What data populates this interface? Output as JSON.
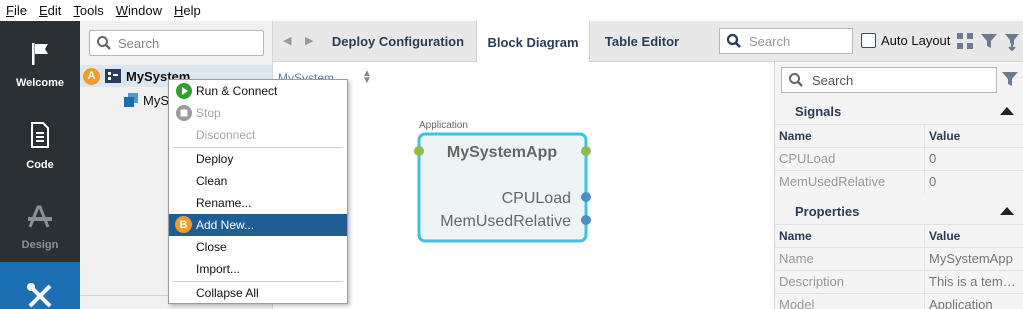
{
  "menubar": {
    "items": [
      {
        "label": "File",
        "u": "F",
        "rest": "ile"
      },
      {
        "label": "Edit",
        "u": "E",
        "rest": "dit"
      },
      {
        "label": "Tools",
        "u": "T",
        "rest": "ools"
      },
      {
        "label": "Window",
        "u": "W",
        "rest": "indow"
      },
      {
        "label": "Help",
        "u": "H",
        "rest": "elp"
      }
    ]
  },
  "rail": {
    "welcome": "Welcome",
    "code": "Code",
    "design": "Design"
  },
  "explorer": {
    "search_placeholder": "Search",
    "root_badge": "A",
    "root_label": "MySystem",
    "child_label": "MyS"
  },
  "navbar": {
    "tabs": [
      "Deploy Configuration",
      "Block Diagram",
      "Table Editor"
    ],
    "active_tab": "Block Diagram",
    "search_placeholder": "Search",
    "auto_layout": "Auto Layout"
  },
  "canvas": {
    "breadcrumb": "MySystem",
    "block": {
      "stereotype": "Application",
      "name": "MySystemApp",
      "ports": [
        "CPULoad",
        "MemUsedRelative"
      ]
    }
  },
  "properties": {
    "search_placeholder": "Search",
    "signals": {
      "title": "Signals",
      "col_name": "Name",
      "col_value": "Value",
      "rows": [
        {
          "name": "CPULoad",
          "value": "0"
        },
        {
          "name": "MemUsedRelative",
          "value": "0"
        }
      ]
    },
    "props": {
      "title": "Properties",
      "col_name": "Name",
      "col_value": "Value",
      "rows": [
        {
          "name": "Name",
          "value": "MySystemApp"
        },
        {
          "name": "Description",
          "value": "This is a tem…"
        },
        {
          "name": "Model",
          "value": "Application"
        }
      ]
    }
  },
  "context_menu": {
    "badge": "B",
    "items": [
      {
        "label": "Run & Connect"
      },
      {
        "label": "Stop"
      },
      {
        "label": "Disconnect"
      },
      {
        "label": "Deploy"
      },
      {
        "label": "Clean"
      },
      {
        "label": "Rename..."
      },
      {
        "label": "Add New..."
      },
      {
        "label": "Close"
      },
      {
        "label": "Import..."
      },
      {
        "label": "Collapse All"
      }
    ]
  },
  "colors": {
    "rail_bg": "#2b3034",
    "rail_active": "#1d6fb3",
    "menu_highlight": "#1e5e94",
    "badge_orange": "#f39b2b",
    "block_border": "#3cc3df",
    "port_green": "#8fbc4a",
    "port_blue": "#4b8fc8",
    "run_green": "#2ea02e"
  }
}
